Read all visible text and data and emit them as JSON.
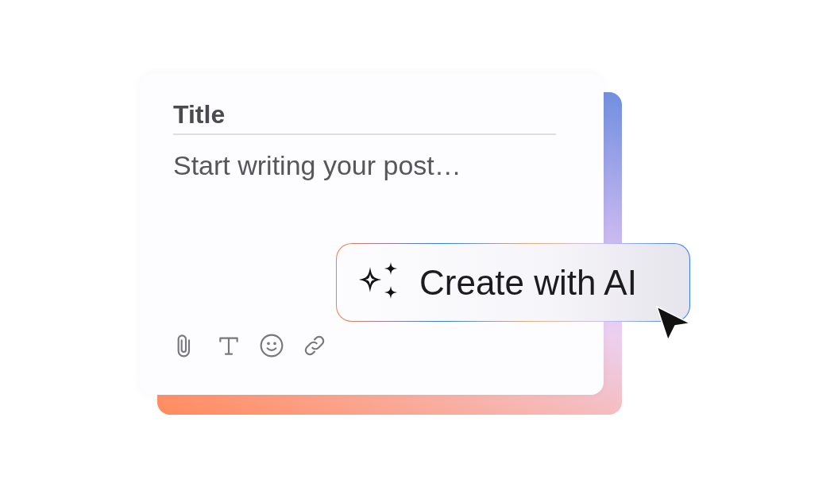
{
  "editor": {
    "title_placeholder": "Title",
    "body_placeholder": "Start writing your post…"
  },
  "toolbar": [
    {
      "kind": "attach"
    },
    {
      "kind": "text"
    },
    {
      "kind": "emoji"
    },
    {
      "kind": "link"
    }
  ],
  "ai_button": {
    "label": "Create with AI"
  }
}
